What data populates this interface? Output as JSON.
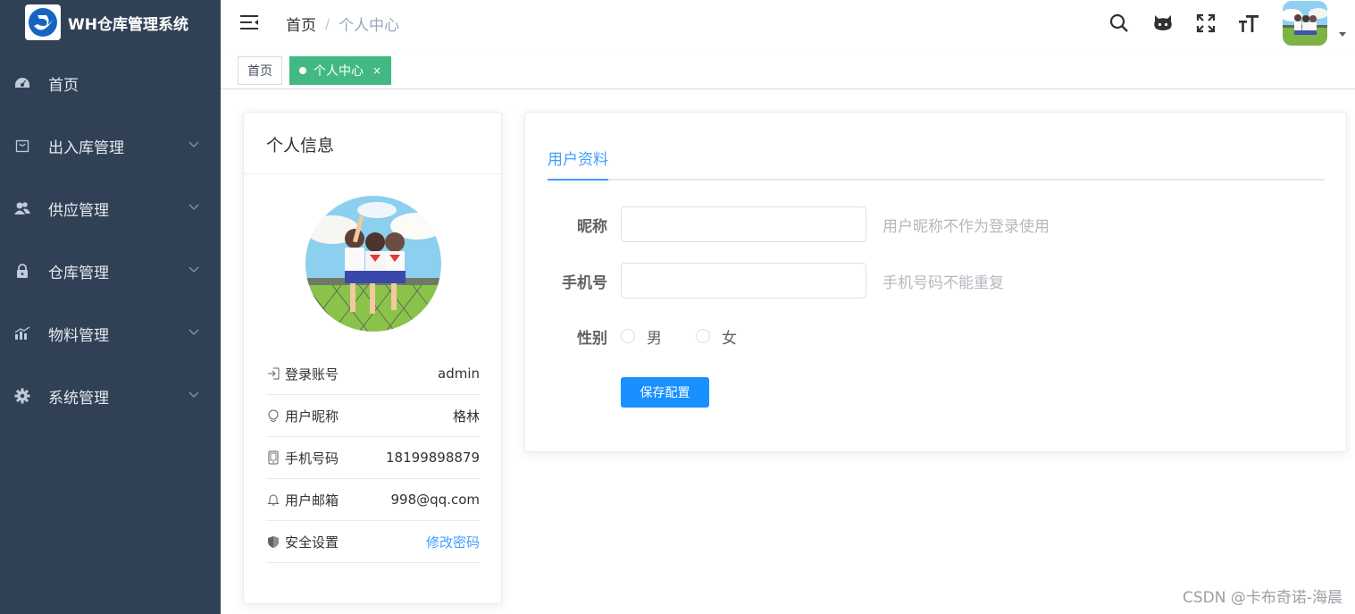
{
  "app": {
    "title": "WH仓库管理系统"
  },
  "sidebar": {
    "items": [
      {
        "label": "首页",
        "icon": "dashboard-icon",
        "has_children": false
      },
      {
        "label": "出入库管理",
        "icon": "shopping-bag-icon",
        "has_children": true
      },
      {
        "label": "供应管理",
        "icon": "peoples-icon",
        "has_children": true
      },
      {
        "label": "仓库管理",
        "icon": "lock-icon",
        "has_children": true
      },
      {
        "label": "物料管理",
        "icon": "chart-icon",
        "has_children": true
      },
      {
        "label": "系统管理",
        "icon": "gear-icon",
        "has_children": true
      }
    ]
  },
  "navbar": {
    "breadcrumb": {
      "home": "首页",
      "separator": "/",
      "current": "个人中心"
    },
    "actions": [
      "search-icon",
      "github-icon",
      "fullscreen-icon",
      "font-size-icon"
    ]
  },
  "tags": {
    "items": [
      {
        "label": "首页",
        "active": false
      },
      {
        "label": "个人中心",
        "active": true,
        "close": "×"
      }
    ]
  },
  "profile_card": {
    "title": "个人信息",
    "rows": [
      {
        "label": "登录账号",
        "value": "admin",
        "icon": "login-icon"
      },
      {
        "label": "用户昵称",
        "value": "格林",
        "icon": "user-icon"
      },
      {
        "label": "手机号码",
        "value": "18199898879",
        "icon": "phone-icon"
      },
      {
        "label": "用户邮箱",
        "value": "998@qq.com",
        "icon": "email-icon"
      },
      {
        "label": "安全设置",
        "value": "修改密码",
        "icon": "shield-icon"
      }
    ]
  },
  "form_card": {
    "tab": "用户资料",
    "nickname": {
      "label": "昵称",
      "value": "",
      "hint": "用户昵称不作为登录使用"
    },
    "phone": {
      "label": "手机号",
      "value": "",
      "hint": "手机号码不能重复"
    },
    "gender": {
      "label": "性别",
      "options": [
        "男",
        "女"
      ]
    },
    "save_label": "保存配置"
  },
  "watermark": "CSDN @卡布奇诺-海晨",
  "colors": {
    "sidebar_bg": "#304156",
    "accent": "#409eff",
    "tag_active": "#42b983",
    "button": "#1890ff"
  }
}
